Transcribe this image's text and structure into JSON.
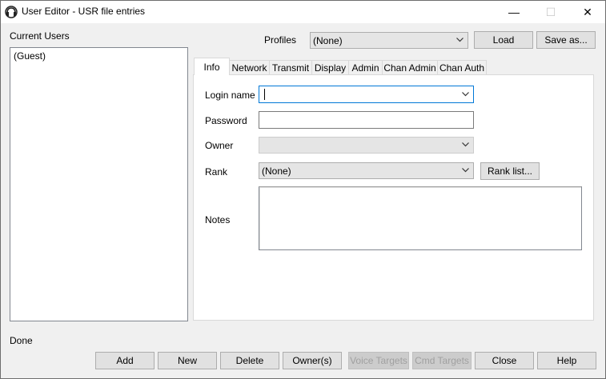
{
  "window": {
    "title": "User Editor - USR file entries",
    "minimize_glyph": "—",
    "maximize_glyph": "☐",
    "close_glyph": "✕"
  },
  "users": {
    "label": "Current Users",
    "items": [
      "(Guest)"
    ]
  },
  "profiles": {
    "label": "Profiles",
    "selected": "(None)",
    "load_label": "Load",
    "save_as_label": "Save as..."
  },
  "tabs": [
    {
      "label": "Info",
      "active": true
    },
    {
      "label": "Network"
    },
    {
      "label": "Transmit"
    },
    {
      "label": "Display"
    },
    {
      "label": "Admin"
    },
    {
      "label": "Chan Admin"
    },
    {
      "label": "Chan Auth"
    }
  ],
  "info": {
    "login_label": "Login name",
    "login_value": "",
    "password_label": "Password",
    "password_value": "",
    "owner_label": "Owner",
    "owner_value": "",
    "rank_label": "Rank",
    "rank_value": "(None)",
    "rank_list_label": "Rank list...",
    "notes_label": "Notes",
    "notes_value": ""
  },
  "status": "Done",
  "buttons": {
    "add": "Add",
    "new": "New",
    "delete": "Delete",
    "owners": "Owner(s)",
    "voice_targets": "Voice Targets",
    "cmd_targets": "Cmd Targets",
    "close": "Close",
    "help": "Help"
  }
}
